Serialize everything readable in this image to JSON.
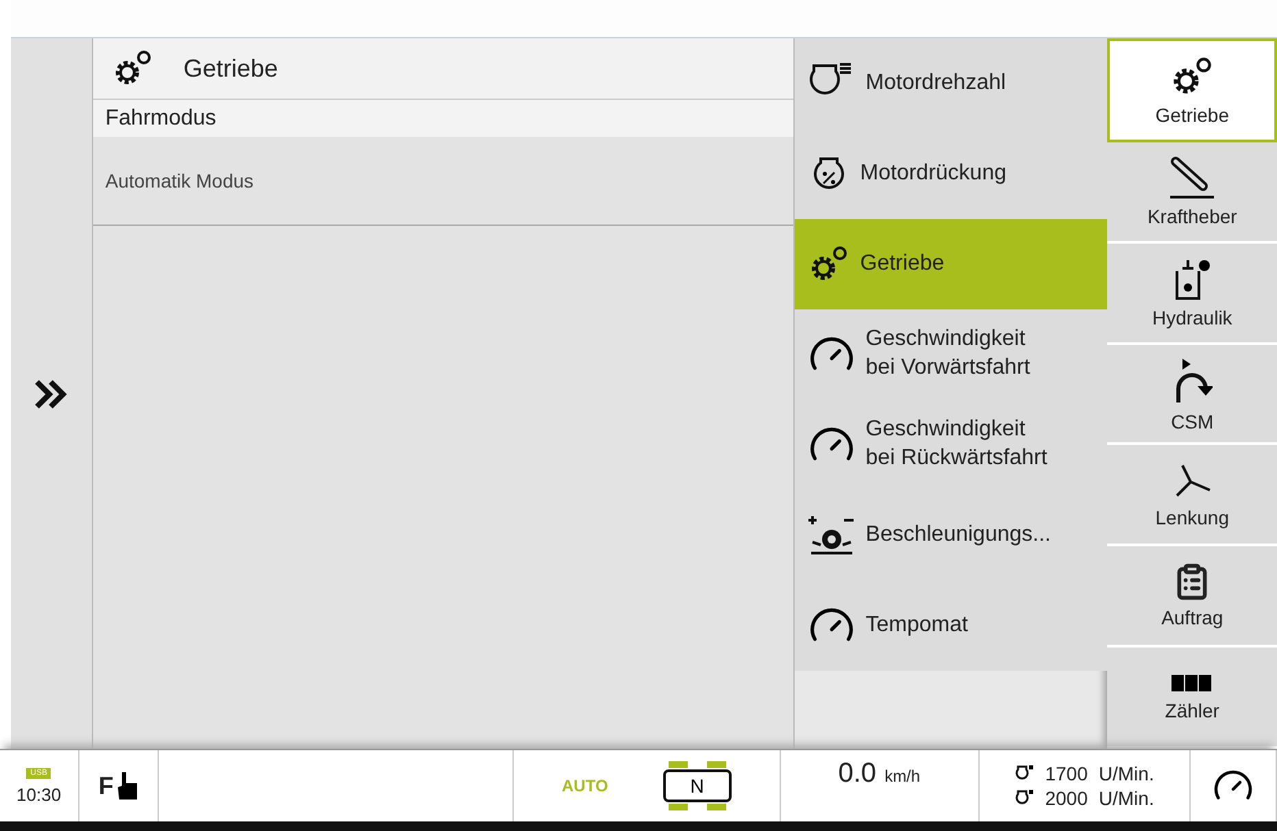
{
  "panel": {
    "title": "Getriebe",
    "section": "Fahrmodus",
    "value": "Automatik Modus"
  },
  "menu": [
    {
      "lines": [
        "Motordrehzahl"
      ],
      "selected": false
    },
    {
      "lines": [
        "Motordrückung"
      ],
      "selected": false
    },
    {
      "lines": [
        "Getriebe"
      ],
      "selected": true
    },
    {
      "lines": [
        "Geschwindigkeit",
        "bei Vorwärtsfahrt"
      ],
      "selected": false
    },
    {
      "lines": [
        "Geschwindigkeit",
        "bei Rückwärtsfahrt"
      ],
      "selected": false
    },
    {
      "lines": [
        "Beschleunigungs..."
      ],
      "selected": false
    },
    {
      "lines": [
        "Tempomat"
      ],
      "selected": false
    }
  ],
  "tabs": [
    {
      "label": "Getriebe",
      "selected": true
    },
    {
      "label": "Kraftheber",
      "selected": false
    },
    {
      "label": "Hydraulik",
      "selected": false
    },
    {
      "label": "CSM",
      "selected": false
    },
    {
      "label": "Lenkung",
      "selected": false
    },
    {
      "label": "Auftrag",
      "selected": false
    },
    {
      "label": "Zähler",
      "selected": false
    }
  ],
  "status_bar": {
    "usb": "USB",
    "time": "10:30",
    "f_key": "F",
    "mode": "AUTO",
    "gear": "N",
    "speed": "0.0",
    "speed_unit": "km/h",
    "rpm": [
      {
        "value": "1700",
        "unit": "U/Min."
      },
      {
        "value": "2000",
        "unit": "U/Min."
      }
    ]
  }
}
